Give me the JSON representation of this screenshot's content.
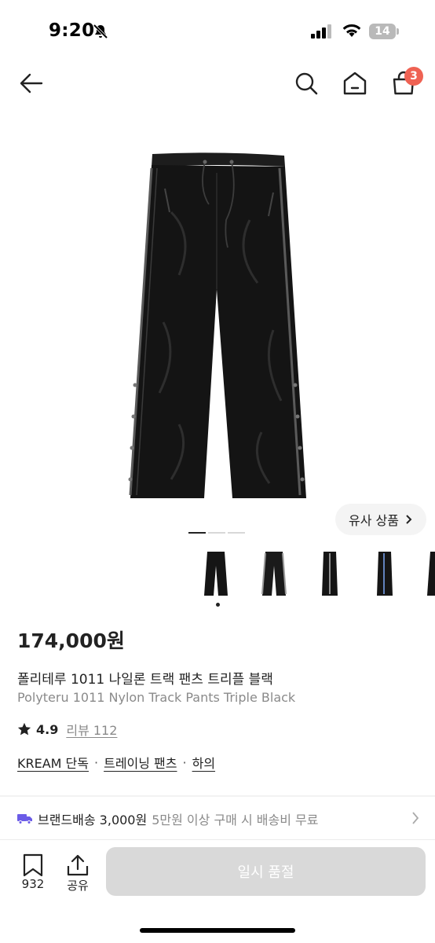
{
  "status_bar": {
    "time": "9:20",
    "battery": "14"
  },
  "header": {
    "cart_badge": "3"
  },
  "gallery": {
    "similar_label": "유사 상품",
    "active_page": 1,
    "page_count": 3
  },
  "product": {
    "price": "174,000원",
    "name_ko": "폴리테루 1011 나일론 트랙 팬츠 트리플 블랙",
    "name_en": "Polyteru 1011 Nylon Track Pants Triple Black",
    "rating": "4.9",
    "review_label": "리뷰 112",
    "tags": [
      "KREAM 단독",
      "트레이닝 팬츠",
      "하의"
    ],
    "tag_separator": "·"
  },
  "shipping": {
    "label": "브랜드배송 3,000원",
    "description": "5만원 이상 구매 시 배송비 무료"
  },
  "bottom_bar": {
    "wish_count": "932",
    "share_label": "공유",
    "soldout_label": "일시 품절"
  },
  "colors": {
    "badge": "#ef6253",
    "shipping_icon": "#6b5ce7",
    "disabled_button": "#d9d9d9"
  }
}
